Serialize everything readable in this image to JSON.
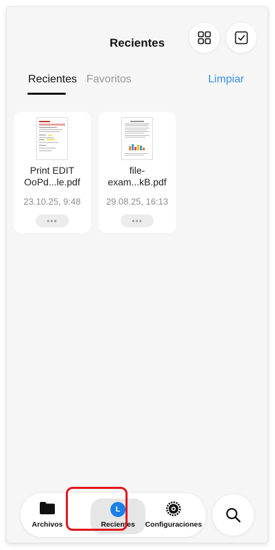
{
  "header": {
    "title": "Recientes",
    "grid_icon": "grid-icon",
    "select_icon": "checkbox-icon"
  },
  "tabs": [
    {
      "label": "Recientes",
      "active": true
    },
    {
      "label": "Favoritos",
      "active": false
    }
  ],
  "clear_label": "Limpiar",
  "files": [
    {
      "name_line1": "Print EDIT",
      "name_line2": "OoPd...le.pdf",
      "date": "23.10.25, 9:48"
    },
    {
      "name_line1": "file-",
      "name_line2": "exam...kB.pdf",
      "date": "29.08.25, 16:13"
    }
  ],
  "more_label": "•••",
  "bottom_nav": {
    "items": [
      {
        "label": "Archivos",
        "icon": "folder-icon"
      },
      {
        "label": "Recientes",
        "icon": "avatar-icon",
        "avatar_letter": "L",
        "selected": true
      },
      {
        "label": "Configuraciones",
        "icon": "gear-icon"
      }
    ],
    "search_icon": "search-icon"
  },
  "colors": {
    "accent": "#3b8ee8",
    "avatar": "#1a7fe8",
    "highlight": "#e0151a"
  }
}
